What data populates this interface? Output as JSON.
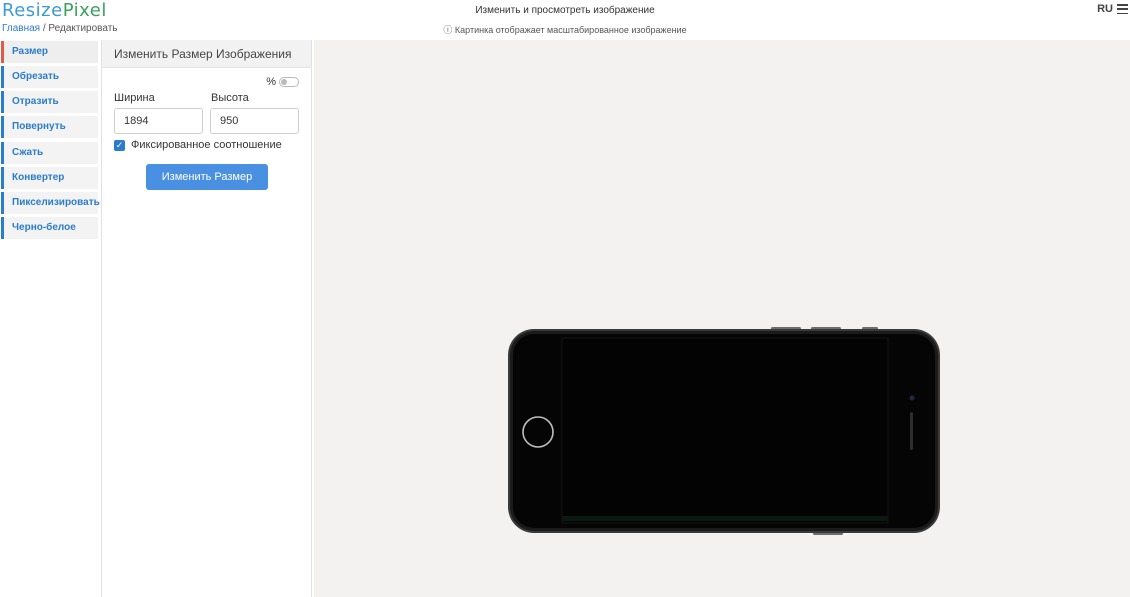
{
  "header": {
    "logo_part1": "Resize",
    "logo_part2": "Pixel",
    "breadcrumb_home": "Главная",
    "breadcrumb_sep": " / ",
    "breadcrumb_current": "Редактировать",
    "title": "Изменить и просмотреть изображение",
    "note": "ⓘ Картинка отображает масштабированное изображение",
    "lang": "RU",
    "menu_icon": "hamburger-icon"
  },
  "sidebar": {
    "items": [
      {
        "label": "Размер",
        "active": true
      },
      {
        "label": "Обрезать"
      },
      {
        "label": "Отразить"
      },
      {
        "label": "Повернуть"
      },
      {
        "label": "Сжать"
      },
      {
        "label": "Конвертер"
      },
      {
        "label": "Пикселизировать"
      },
      {
        "label": "Черно-белое"
      }
    ]
  },
  "panel": {
    "title": "Изменить Размер Изображения",
    "percent_label": "%",
    "percent_toggle": false,
    "width_label": "Ширина",
    "width_value": "1894",
    "height_label": "Высота",
    "height_value": "950",
    "keep_ratio_label": "Фиксированное соотношение",
    "keep_ratio_checked": true,
    "submit_label": "Изменить Размер"
  },
  "colors": {
    "accent": "#2a7ccf",
    "button": "#4a90e2",
    "active_marker": "#e05a47",
    "canvas_bg": "#f3f2f0"
  }
}
